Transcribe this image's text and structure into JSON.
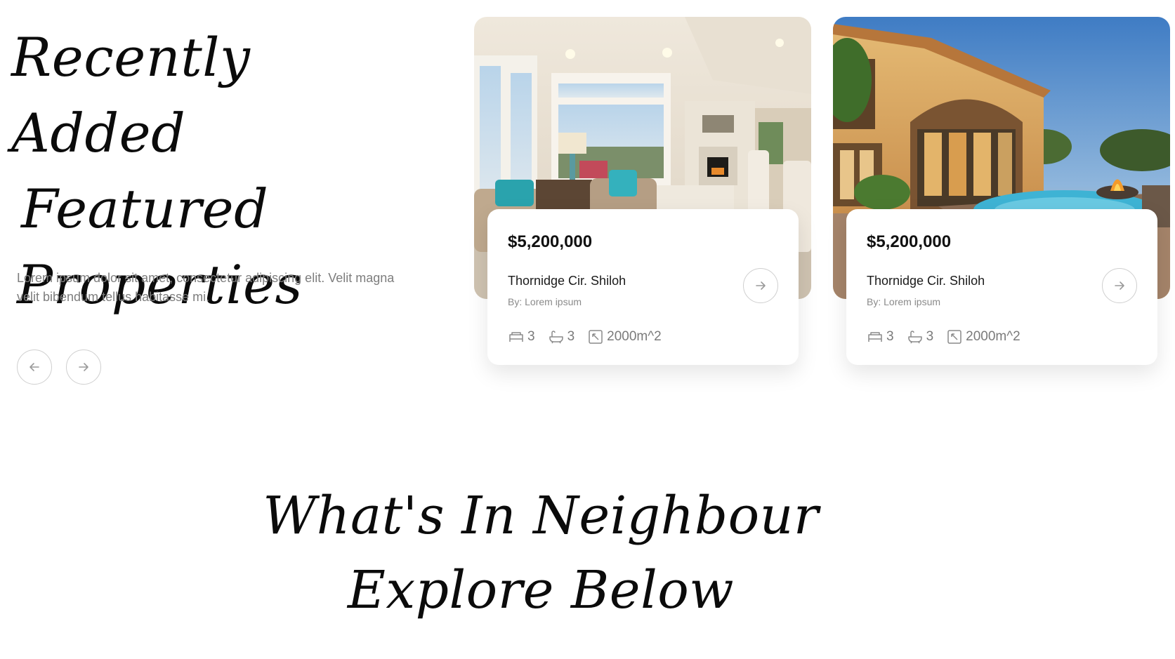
{
  "hero": {
    "title_lines": [
      "Recently Added",
      "Featured",
      "Properties"
    ],
    "description": "Lorem ipsum dolor sit amet, consectetur adipiscing elit. Velit magna velit bibendum tellus habitasse mi."
  },
  "slider": {
    "prev_icon": "arrow-left-icon",
    "next_icon": "arrow-right-icon"
  },
  "cards": [
    {
      "photo": "living-room-interior",
      "price": "$5,200,000",
      "address": "Thornidge Cir. Shiloh",
      "author": "By: Lorem ipsum",
      "beds": "3",
      "baths": "3",
      "area": "2000m^2"
    },
    {
      "photo": "villa-pool-exterior",
      "price": "$5,200,000",
      "address": "Thornidge Cir. Shiloh",
      "author": "By: Lorem ipsum",
      "beds": "3",
      "baths": "3",
      "area": "2000m^2"
    }
  ],
  "neighbour": {
    "title_lines": [
      "What's In Neighbour",
      "Explore Below"
    ]
  },
  "colors": {
    "text": "#0b0b0b",
    "muted": "#7d7d7d",
    "border": "#cfcfcf",
    "card_bg": "#ffffff"
  }
}
